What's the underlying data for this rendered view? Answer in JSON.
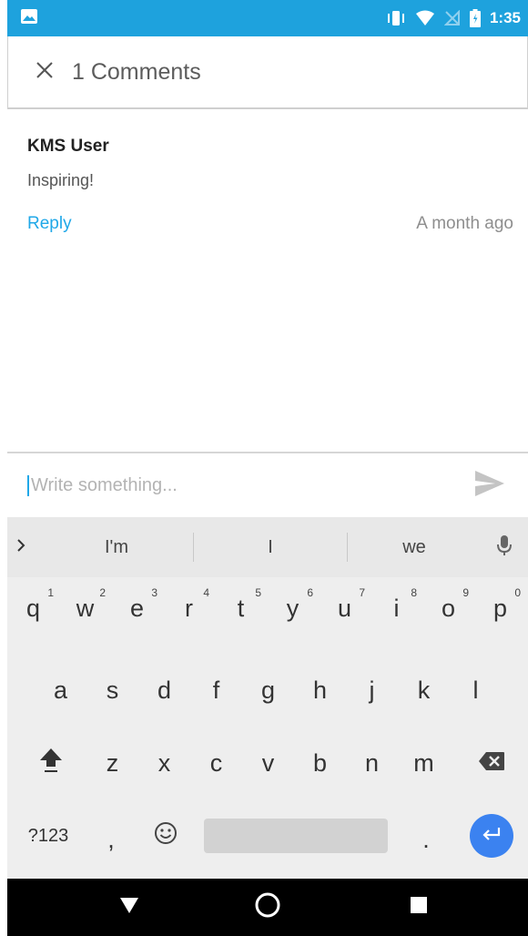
{
  "status_bar": {
    "time": "1:35",
    "icons": [
      "image-notification-icon",
      "vibrate-icon",
      "wifi-icon",
      "no-sim-icon",
      "battery-icon"
    ]
  },
  "header": {
    "title": "1 Comments",
    "close_icon": "close-icon"
  },
  "comment": {
    "author": "KMS User",
    "text": "Inspiring!",
    "reply_label": "Reply",
    "timestamp": "A month ago"
  },
  "composer": {
    "placeholder": "Write something...",
    "value": "",
    "send_icon": "send-icon"
  },
  "keyboard": {
    "suggestions": [
      "I'm",
      "I",
      "we"
    ],
    "row1": [
      {
        "key": "q",
        "hint": "1"
      },
      {
        "key": "w",
        "hint": "2"
      },
      {
        "key": "e",
        "hint": "3"
      },
      {
        "key": "r",
        "hint": "4"
      },
      {
        "key": "t",
        "hint": "5"
      },
      {
        "key": "y",
        "hint": "6"
      },
      {
        "key": "u",
        "hint": "7"
      },
      {
        "key": "i",
        "hint": "8"
      },
      {
        "key": "o",
        "hint": "9"
      },
      {
        "key": "p",
        "hint": "0"
      }
    ],
    "row2": [
      "a",
      "s",
      "d",
      "f",
      "g",
      "h",
      "j",
      "k",
      "l"
    ],
    "row3": [
      "z",
      "x",
      "c",
      "v",
      "b",
      "n",
      "m"
    ],
    "symbols_label": "?123",
    "comma_label": ",",
    "period_label": ".",
    "icons": [
      "chevron-right-icon",
      "mic-icon",
      "shift-icon",
      "backspace-icon",
      "emoji-icon",
      "enter-icon"
    ]
  },
  "nav_bar": {
    "icons": [
      "back-icon",
      "home-icon",
      "recents-icon"
    ]
  },
  "colors": {
    "status_bar": "#1ea2dd",
    "accent": "#20a8e8",
    "enter_key": "#3b82f0"
  }
}
